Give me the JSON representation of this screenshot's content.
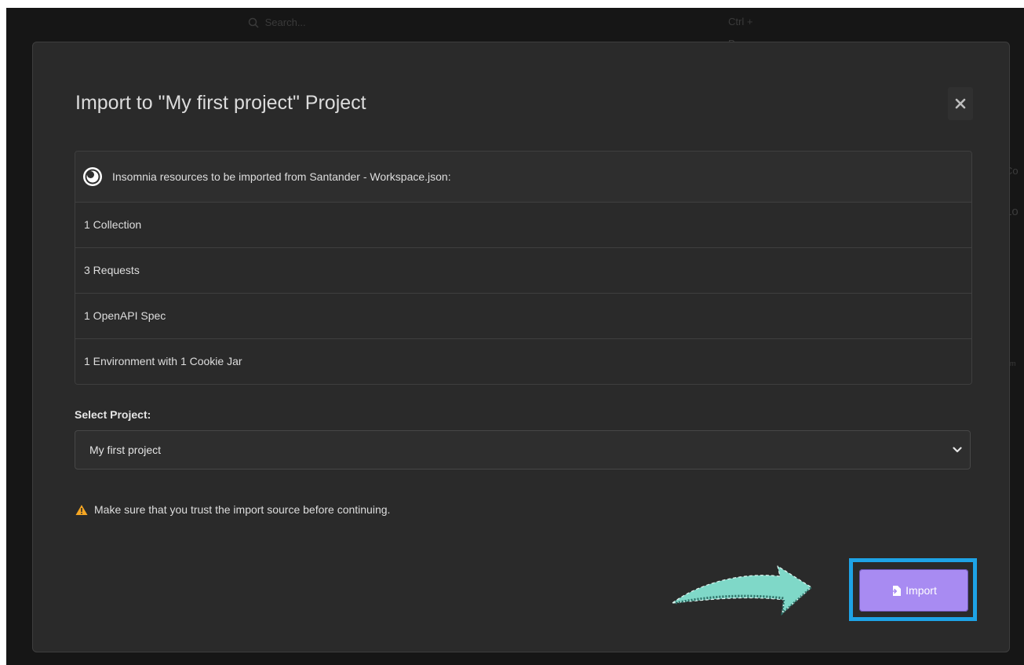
{
  "background": {
    "search_placeholder": "Search...",
    "search_shortcut": "Ctrl + P",
    "edge_text_1": "Co",
    "edge_text_2": "Lo",
    "edge_text_3": "m"
  },
  "modal": {
    "title": "Import to \"My first project\" Project",
    "close_label": "×",
    "resources_header": "Insomnia resources to be imported from Santander - Workspace.json:",
    "resources": [
      "1 Collection",
      "3 Requests",
      "1 OpenAPI Spec",
      "1 Environment with 1 Cookie Jar"
    ],
    "select_label": "Select Project:",
    "select_value": "My first project",
    "warning": "Make sure that you trust the import source before continuing.",
    "import_label": "Import"
  },
  "colors": {
    "accent": "#a88bf2",
    "highlight": "#1ea3e6",
    "warning": "#f5a623",
    "arrow": "#7fd8c8"
  },
  "icons": {
    "search": "search-icon",
    "close": "close-icon",
    "insomnia": "insomnia-logo-icon",
    "chevron": "chevron-down-icon",
    "warning": "warning-icon",
    "import": "import-icon",
    "arrow": "arrow-decoration"
  }
}
